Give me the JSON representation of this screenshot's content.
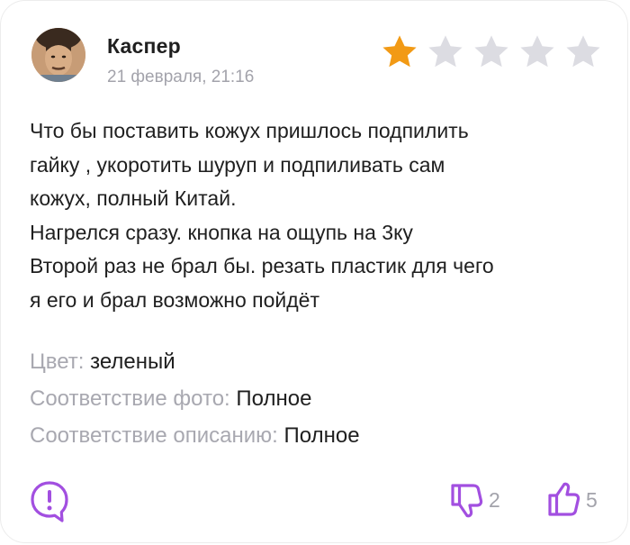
{
  "review": {
    "author": "Каспер",
    "date": "21 февраля, 21:16",
    "rating": 1,
    "rating_max": 5,
    "text_lines": [
      "Что бы поставить кожух пришлось подпилить",
      "гайку , укоротить шуруп и подпиливать сам",
      "кожух, полный Китай.",
      "Нагрелся сразу. кнопка на ощупь на 3ку",
      "Второй раз не брал бы. резать пластик для чего",
      "я его и брал возможно пойдёт"
    ],
    "attributes": [
      {
        "key": "Цвет:",
        "value": "зеленый"
      },
      {
        "key": "Соответствие фото:",
        "value": "Полное"
      },
      {
        "key": "Соответствие описанию:",
        "value": "Полное"
      }
    ],
    "dislikes": "2",
    "likes": "5"
  },
  "colors": {
    "star_active": "#f29a15",
    "star_inactive": "#dcdce2",
    "accent": "#a24fe0",
    "muted": "#a3a3ab"
  },
  "icons": {
    "report": "exclamation-circle-icon",
    "dislike": "thumbs-down-icon",
    "like": "thumbs-up-icon",
    "star": "star-icon"
  }
}
